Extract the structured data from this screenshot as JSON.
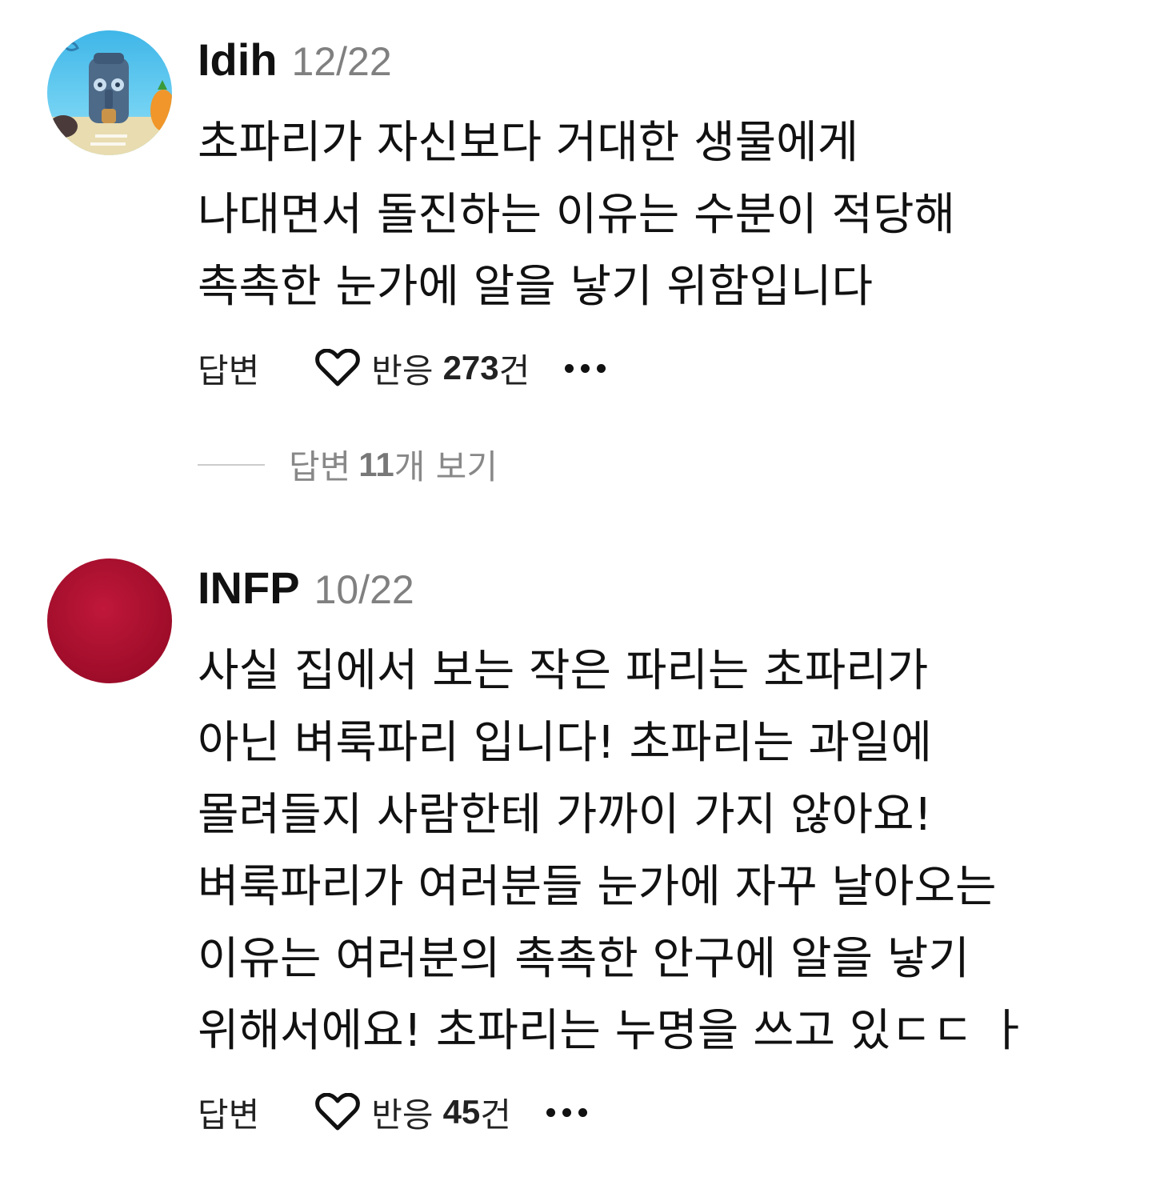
{
  "comments": [
    {
      "username": "Idih",
      "date": "12/22",
      "avatar_icon": "squidward-house-avatar",
      "body_lines": [
        "초파리가 자신보다 거대한 생물에게",
        "나대면서 돌진하는 이유는 수분이 적당해",
        "촉촉한 눈가에 알을 낳기 위함입니다"
      ],
      "reply_label": "답변",
      "reaction_label": "반응",
      "reaction_count": "273",
      "reaction_unit": "건",
      "more_icon": "more-dots-icon",
      "view_replies": {
        "prefix": "답변",
        "count": "11",
        "suffix": "개 보기"
      }
    },
    {
      "username": "INFP",
      "date": "10/22",
      "avatar_icon": "red-circle-avatar",
      "avatar_color": "#b0112e",
      "body_lines": [
        "사실 집에서 보는 작은 파리는 초파리가",
        "아닌 벼룩파리 입니다! 초파리는 과일에",
        "몰려들지 사람한테 가까이 가지 않아요!",
        "벼룩파리가 여러분들 눈가에 자꾸 날아오는",
        "이유는 여러분의 촉촉한 안구에 알을 낳기",
        "위해서에요! 초파리는 누명을 쓰고 있ㄷㄷ ㅏ"
      ],
      "reply_label": "답변",
      "reaction_label": "반응",
      "reaction_count": "45",
      "reaction_unit": "건",
      "more_icon": "more-dots-icon"
    }
  ]
}
